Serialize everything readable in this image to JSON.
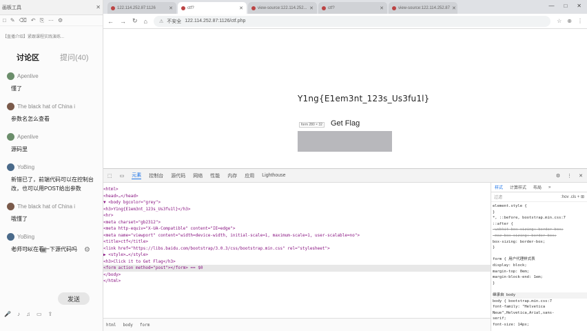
{
  "chat_panel": {
    "title": "画板工具",
    "tools": [
      "□",
      "✎",
      "⌫",
      "↶",
      "⎘",
      "⋯",
      "⚙"
    ],
    "banner": "【直播介绍】紧跟课程实践演练...",
    "tab_active": "讨论区",
    "tab_other": "提问(40)",
    "messages": [
      {
        "user": "Apenlive",
        "text": "懂了"
      },
      {
        "user": "The black hat of China i",
        "text": "参数名怎么查看"
      },
      {
        "user": "Apenlive",
        "text": "源码里"
      },
      {
        "user": "YoBing",
        "text": "新错已了，前端代码可以在控制台改，也可以用POST给出参数"
      },
      {
        "user": "The black hat of China i",
        "text": "哦懂了"
      },
      {
        "user": "YoBing",
        "text": "老师可以在看一下源代码吗"
      }
    ],
    "bottom_icons": [
      "☺",
      "✂",
      "▣",
      "⚙"
    ],
    "send_label": "发送",
    "footer_icons": [
      "🎤",
      "♪",
      "♫",
      "▭",
      "⇪"
    ]
  },
  "browser": {
    "tabs": [
      {
        "label": "122.114.252.87:1126",
        "active": false
      },
      {
        "label": "ctf?",
        "active": true
      },
      {
        "label": "view-source:122.114.252...",
        "active": false
      },
      {
        "label": "ctf?",
        "active": false
      },
      {
        "label": "view-source:122.114.252.87",
        "active": false
      }
    ],
    "win_controls": [
      "—",
      "□",
      "✕"
    ],
    "nav": [
      "←",
      "→",
      "↻",
      "⌂"
    ],
    "security": "不安全",
    "url": "122.114.252.87:1126/ctf.php",
    "url_tools": [
      "☆",
      "⊕",
      "⋮"
    ]
  },
  "page": {
    "flag": "Y1ng{E1em3nt_123s_Us3fu1l}",
    "form_tip": "form  280 × 32",
    "get_flag": "Get Flag"
  },
  "devtools": {
    "tabs": [
      "元素",
      "控制台",
      "源代码",
      "网络",
      "性能",
      "内存",
      "应用",
      "Lighthouse"
    ],
    "active_tab": "元素",
    "toolbar_right": [
      "⚙",
      "⋮",
      "✕"
    ],
    "code_lines": [
      "<html>",
      "  <head>…</head>",
      "▼ <body bgcolor=\"grey\">",
      "    <h3>Y1ng{E1em3nt_123s_Us3fu1l}</h3>",
      "    <hr>",
      "    <meta charset=\"gb2312\">",
      "    <meta http-equiv=\"X-UA-Compatible\" content=\"IE=edge\">",
      "    <meta name=\"viewport\" content=\"width=device-width, initial-scale=1, maximum-scale=1, user-scalable=no\">",
      "    <title>ctf</title>",
      "    <link href=\"https://libs.baidu.com/bootstrap/3.0.3/css/bootstrap.min.css\" rel=\"stylesheet\">",
      "  ▶ <style>…</style>",
      "    <h3>Click it to Get Flag</h3>",
      "    <form action method=\"post\"></form> == $0",
      "  </body>",
      "</html>"
    ],
    "crumbs": [
      "html",
      "body",
      "form"
    ],
    "styles_tabs": [
      "样式",
      "计算样式",
      "布局",
      "»"
    ],
    "filter_placeholder": "过滤",
    "filter_hov": ":hov .cls + ⊞",
    "style_lines": [
      "element.style {",
      "}",
      "*, ::before,          bootstrap.min.css:7",
      "::after {",
      "  -webkit-box-sizing: border-box;",
      "  -moz-box-sizing: border-box;",
      "  box-sizing: border-box;",
      "}",
      "",
      "form {           用户代理样式表",
      "  display: block;",
      "  margin-top: 0em;",
      "  margin-block-end: 1em;",
      "}",
      "",
      "继承自 body",
      "body {           bootstrap.min.css:7",
      "  font-family: \"Helvetica",
      "    Neue\",Helvetica,Arial,sans-",
      "    serif;",
      "  font-size: 14px;"
    ]
  }
}
